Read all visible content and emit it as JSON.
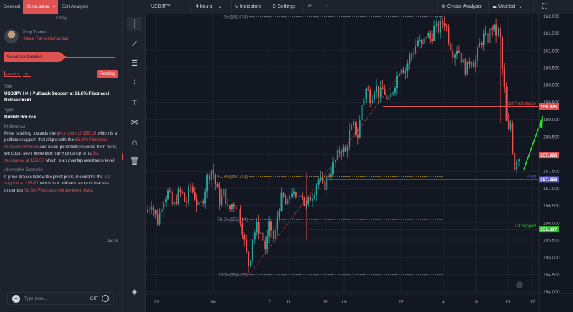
{
  "tabs": [
    "General",
    "Discussion",
    "Edit Analysis"
  ],
  "tab_close_icon": "×",
  "today_label": "Today",
  "author": {
    "role": "Prop Trader",
    "name": "Ketan Rameshchandra"
  },
  "status_flag": "Analysis Created",
  "badges": [
    "USDJPY",
    "H4"
  ],
  "pending_label": "Pending",
  "title_label": "Title",
  "title_value": "USDJPY H4 | Pullback Support at 61.8% Fibonacci Retracement",
  "type_label": "Type",
  "type_value": "Bullish Bounce",
  "preference_label": "Preference:",
  "preference_parts": [
    "Price is falling towards the ",
    "pivot point of 157.25",
    " which is a pullback support that aligns with the ",
    "61.8% Fibonacci retracement level",
    " and could potentially reverse from here; we could see momentum carry price up to its ",
    "1st resistance at 159.37",
    " which is an overlap resistance level."
  ],
  "alternative_label": "Alternative Scenario:",
  "alternative_parts": [
    "If price breaks below the pivot point, it could hit the ",
    "1st support at 155.81",
    " which is a pullback support that sits under the ",
    "78.6% Fibonacci retracement level",
    "."
  ],
  "message_time": "15:16",
  "reply_placeholder": "Type here...",
  "gif_label": "GIF",
  "toolbar": {
    "symbol": "USDJPY",
    "interval": "4 hours",
    "indicators": "Indicators",
    "settings": "Settings",
    "create_analysis": "Create Analysis",
    "layout_name": "Untitled"
  },
  "colors": {
    "accent": "#e05252",
    "up": "#26a69a",
    "down": "#ef5350",
    "pivot": "#5b5bd6",
    "support": "#26c026",
    "arrow": "#27e627"
  },
  "chart_data": {
    "type": "candlestick",
    "symbol": "USDJPY",
    "timeframe": "4 hours",
    "y_ticks": [
      "162.000",
      "161.500",
      "161.000",
      "160.500",
      "160.000",
      "159.500",
      "159.000",
      "158.500",
      "158.000",
      "157.500",
      "157.000",
      "156.500",
      "156.000",
      "155.500",
      "155.000",
      "154.500",
      "154.000"
    ],
    "ylim": [
      153.95,
      162.05
    ],
    "x_ticks": [
      "22",
      "30",
      "7",
      "11",
      "15",
      "19",
      "27",
      "4",
      "9",
      "13",
      "17"
    ],
    "levels": [
      {
        "label": "1st Resistance",
        "value": 159.375,
        "tag": "159.375",
        "color": "#e05252"
      },
      {
        "label": "Pivot",
        "value": 157.258,
        "tag": "157.258",
        "color": "#5b5bd6"
      },
      {
        "label": "1st Support",
        "value": 155.817,
        "tag": "155.817",
        "color": "#26c026"
      }
    ],
    "current_price": "157.966",
    "fibonacci": [
      {
        "label": "0%(161.974)",
        "value": 161.974
      },
      {
        "label": "61.8%(157.351)",
        "value": 157.351
      },
      {
        "label": "78.6%(156.094)",
        "value": 156.094
      },
      {
        "label": "100%(154.493)",
        "value": 154.493
      }
    ],
    "path": [
      [
        0,
        156.3
      ],
      [
        8,
        156.6
      ],
      [
        16,
        156.0
      ],
      [
        24,
        156.7
      ],
      [
        32,
        156.9
      ],
      [
        38,
        156.4
      ],
      [
        44,
        156.8
      ],
      [
        50,
        156.9
      ],
      [
        56,
        156.5
      ],
      [
        62,
        157.1
      ],
      [
        68,
        156.8
      ],
      [
        75,
        156.4
      ],
      [
        80,
        156.7
      ],
      [
        86,
        157.3
      ],
      [
        93,
        157.6
      ],
      [
        98,
        157.1
      ],
      [
        104,
        156.6
      ],
      [
        110,
        156.9
      ],
      [
        116,
        156.3
      ],
      [
        122,
        156.6
      ],
      [
        128,
        156.5
      ],
      [
        134,
        156.0
      ],
      [
        140,
        155.2
      ],
      [
        145,
        154.7
      ],
      [
        150,
        155.6
      ],
      [
        156,
        155.9
      ],
      [
        162,
        155.7
      ],
      [
        168,
        155.2
      ],
      [
        174,
        156.0
      ],
      [
        180,
        155.4
      ],
      [
        186,
        156.4
      ],
      [
        192,
        156.8
      ],
      [
        198,
        156.4
      ],
      [
        204,
        157.0
      ],
      [
        210,
        156.6
      ],
      [
        218,
        157.0
      ],
      [
        224,
        156.4
      ],
      [
        230,
        156.7
      ],
      [
        236,
        156.9
      ],
      [
        242,
        157.3
      ],
      [
        250,
        157.0
      ],
      [
        256,
        157.4
      ],
      [
        262,
        157.6
      ],
      [
        268,
        157.9
      ],
      [
        274,
        158.2
      ],
      [
        280,
        158.0
      ],
      [
        286,
        158.6
      ],
      [
        292,
        158.8
      ],
      [
        298,
        158.5
      ],
      [
        304,
        159.5
      ],
      [
        310,
        159.9
      ],
      [
        316,
        159.6
      ],
      [
        322,
        160.0
      ],
      [
        328,
        159.7
      ],
      [
        334,
        159.9
      ],
      [
        340,
        159.4
      ],
      [
        346,
        159.8
      ],
      [
        352,
        160.2
      ],
      [
        358,
        160.6
      ],
      [
        364,
        160.4
      ],
      [
        370,
        160.8
      ],
      [
        376,
        161.0
      ],
      [
        382,
        161.3
      ],
      [
        388,
        161.1
      ],
      [
        394,
        161.5
      ],
      [
        400,
        161.3
      ],
      [
        406,
        161.7
      ],
      [
        412,
        161.6
      ],
      [
        418,
        161.9
      ],
      [
        422,
        161.7
      ],
      [
        426,
        161.3
      ],
      [
        432,
        160.9
      ],
      [
        438,
        161.1
      ],
      [
        444,
        160.7
      ],
      [
        450,
        160.4
      ],
      [
        456,
        160.8
      ],
      [
        462,
        160.6
      ],
      [
        468,
        161.1
      ],
      [
        474,
        161.4
      ],
      [
        480,
        161.3
      ],
      [
        486,
        161.7
      ],
      [
        492,
        161.5
      ],
      [
        497,
        161.6
      ],
      [
        500,
        160.6
      ],
      [
        504,
        159.8
      ],
      [
        508,
        158.4
      ],
      [
        512,
        159.0
      ],
      [
        515,
        158.2
      ],
      [
        518,
        157.6
      ],
      [
        522,
        158.0
      ],
      [
        526,
        157.8
      ]
    ]
  }
}
